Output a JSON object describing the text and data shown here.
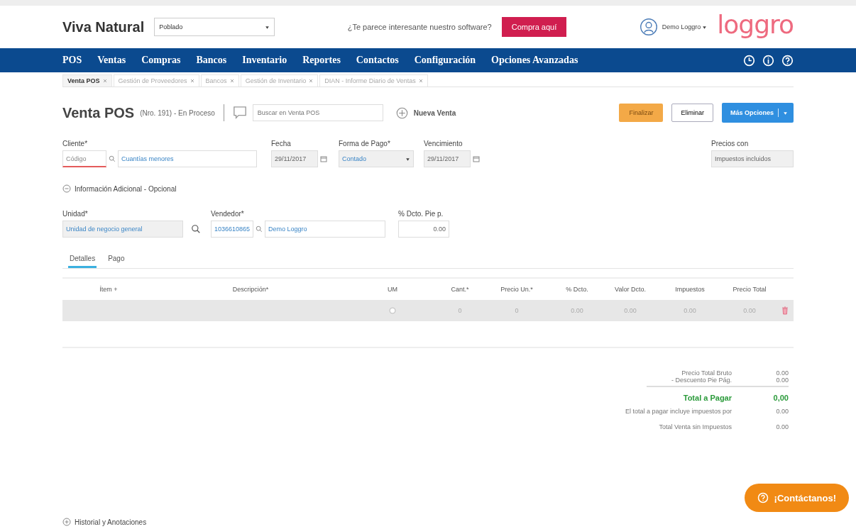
{
  "header": {
    "company": "Viva Natural",
    "branch_select": "Poblado",
    "promo_text": "¿Te parece interesante nuestro software?",
    "promo_button": "Compra aquí",
    "user": "Demo Loggro",
    "logo": "loggro"
  },
  "nav": {
    "items": [
      "POS",
      "Ventas",
      "Compras",
      "Bancos",
      "Inventario",
      "Reportes",
      "Contactos",
      "Configuración",
      "Opciones Avanzadas"
    ]
  },
  "open_tabs": [
    {
      "label": "Venta POS",
      "selected": true
    },
    {
      "label": "Gestión de Proveedores",
      "selected": false
    },
    {
      "label": "Bancos",
      "selected": false
    },
    {
      "label": "Gestión de Inventario",
      "selected": false
    },
    {
      "label": "DIAN - Informe Diario de Ventas",
      "selected": false
    }
  ],
  "page": {
    "title": "Venta POS",
    "subtitle": "(Nro. 191) - En Proceso",
    "search_placeholder": "Buscar en Venta POS",
    "new_sale": "Nueva Venta",
    "buttons": {
      "finalize": "Finalizar",
      "delete": "Eliminar",
      "more": "Más Opciones"
    }
  },
  "form": {
    "cliente_label": "Cliente*",
    "cliente_code_placeholder": "Código",
    "cliente_name": "Cuantías menores",
    "fecha_label": "Fecha",
    "fecha": "29/11/2017",
    "forma_pago_label": "Forma de Pago*",
    "forma_pago": "Contado",
    "vencimiento_label": "Vencimiento",
    "vencimiento": "29/11/2017",
    "precios_label": "Precios con",
    "precios": "Impuestos incluidos"
  },
  "additional": {
    "title": "Información Adicional - Opcional",
    "expanded": true,
    "unidad_label": "Unidad*",
    "unidad": "Unidad de negocio general",
    "vendedor_label": "Vendedor*",
    "vendedor_code": "1036610865",
    "vendedor_name": "Demo Loggro",
    "dcto_label": "% Dcto. Pie p.",
    "dcto": "0.00"
  },
  "detail_tabs": [
    {
      "label": "Detalles",
      "selected": true
    },
    {
      "label": "Pago",
      "selected": false
    }
  ],
  "table": {
    "columns": [
      "Ítem +",
      "Descripción*",
      "UM",
      "Cant.*",
      "Precio Un.*",
      "% Dcto.",
      "Valor Dcto.",
      "Impuestos",
      "Precio Total"
    ],
    "rows": [
      {
        "um_selected": false,
        "cells": [
          "",
          "",
          "",
          "0",
          "0",
          "0.00",
          "0.00",
          "0.00",
          "0.00"
        ]
      }
    ]
  },
  "totals": [
    {
      "label": "Precio Total Bruto",
      "value": "0.00",
      "kind": "plain"
    },
    {
      "label": "- Descuento Pie Pág.",
      "value": "0.00",
      "kind": "plain"
    },
    {
      "label": "Total a Pagar",
      "value": "0,00",
      "kind": "total"
    },
    {
      "label": "El total a pagar incluye impuestos por",
      "value": "0.00",
      "kind": "note"
    },
    {
      "label": "Total Venta sin Impuestos",
      "value": "0.00",
      "kind": "note"
    }
  ],
  "history": {
    "title": "Historial y Anotaciones",
    "expanded": false
  },
  "contact_button": "¡Contáctanos!"
}
